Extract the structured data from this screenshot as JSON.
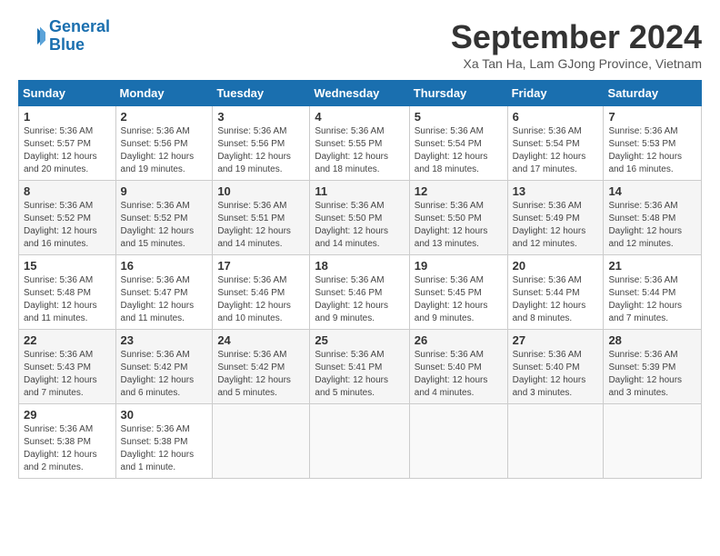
{
  "header": {
    "logo_line1": "General",
    "logo_line2": "Blue",
    "month": "September 2024",
    "location": "Xa Tan Ha, Lam GJong Province, Vietnam"
  },
  "weekdays": [
    "Sunday",
    "Monday",
    "Tuesday",
    "Wednesday",
    "Thursday",
    "Friday",
    "Saturday"
  ],
  "weeks": [
    [
      {
        "day": "1",
        "detail": "Sunrise: 5:36 AM\nSunset: 5:57 PM\nDaylight: 12 hours\nand 20 minutes."
      },
      {
        "day": "2",
        "detail": "Sunrise: 5:36 AM\nSunset: 5:56 PM\nDaylight: 12 hours\nand 19 minutes."
      },
      {
        "day": "3",
        "detail": "Sunrise: 5:36 AM\nSunset: 5:56 PM\nDaylight: 12 hours\nand 19 minutes."
      },
      {
        "day": "4",
        "detail": "Sunrise: 5:36 AM\nSunset: 5:55 PM\nDaylight: 12 hours\nand 18 minutes."
      },
      {
        "day": "5",
        "detail": "Sunrise: 5:36 AM\nSunset: 5:54 PM\nDaylight: 12 hours\nand 18 minutes."
      },
      {
        "day": "6",
        "detail": "Sunrise: 5:36 AM\nSunset: 5:54 PM\nDaylight: 12 hours\nand 17 minutes."
      },
      {
        "day": "7",
        "detail": "Sunrise: 5:36 AM\nSunset: 5:53 PM\nDaylight: 12 hours\nand 16 minutes."
      }
    ],
    [
      {
        "day": "8",
        "detail": "Sunrise: 5:36 AM\nSunset: 5:52 PM\nDaylight: 12 hours\nand 16 minutes."
      },
      {
        "day": "9",
        "detail": "Sunrise: 5:36 AM\nSunset: 5:52 PM\nDaylight: 12 hours\nand 15 minutes."
      },
      {
        "day": "10",
        "detail": "Sunrise: 5:36 AM\nSunset: 5:51 PM\nDaylight: 12 hours\nand 14 minutes."
      },
      {
        "day": "11",
        "detail": "Sunrise: 5:36 AM\nSunset: 5:50 PM\nDaylight: 12 hours\nand 14 minutes."
      },
      {
        "day": "12",
        "detail": "Sunrise: 5:36 AM\nSunset: 5:50 PM\nDaylight: 12 hours\nand 13 minutes."
      },
      {
        "day": "13",
        "detail": "Sunrise: 5:36 AM\nSunset: 5:49 PM\nDaylight: 12 hours\nand 12 minutes."
      },
      {
        "day": "14",
        "detail": "Sunrise: 5:36 AM\nSunset: 5:48 PM\nDaylight: 12 hours\nand 12 minutes."
      }
    ],
    [
      {
        "day": "15",
        "detail": "Sunrise: 5:36 AM\nSunset: 5:48 PM\nDaylight: 12 hours\nand 11 minutes."
      },
      {
        "day": "16",
        "detail": "Sunrise: 5:36 AM\nSunset: 5:47 PM\nDaylight: 12 hours\nand 11 minutes."
      },
      {
        "day": "17",
        "detail": "Sunrise: 5:36 AM\nSunset: 5:46 PM\nDaylight: 12 hours\nand 10 minutes."
      },
      {
        "day": "18",
        "detail": "Sunrise: 5:36 AM\nSunset: 5:46 PM\nDaylight: 12 hours\nand 9 minutes."
      },
      {
        "day": "19",
        "detail": "Sunrise: 5:36 AM\nSunset: 5:45 PM\nDaylight: 12 hours\nand 9 minutes."
      },
      {
        "day": "20",
        "detail": "Sunrise: 5:36 AM\nSunset: 5:44 PM\nDaylight: 12 hours\nand 8 minutes."
      },
      {
        "day": "21",
        "detail": "Sunrise: 5:36 AM\nSunset: 5:44 PM\nDaylight: 12 hours\nand 7 minutes."
      }
    ],
    [
      {
        "day": "22",
        "detail": "Sunrise: 5:36 AM\nSunset: 5:43 PM\nDaylight: 12 hours\nand 7 minutes."
      },
      {
        "day": "23",
        "detail": "Sunrise: 5:36 AM\nSunset: 5:42 PM\nDaylight: 12 hours\nand 6 minutes."
      },
      {
        "day": "24",
        "detail": "Sunrise: 5:36 AM\nSunset: 5:42 PM\nDaylight: 12 hours\nand 5 minutes."
      },
      {
        "day": "25",
        "detail": "Sunrise: 5:36 AM\nSunset: 5:41 PM\nDaylight: 12 hours\nand 5 minutes."
      },
      {
        "day": "26",
        "detail": "Sunrise: 5:36 AM\nSunset: 5:40 PM\nDaylight: 12 hours\nand 4 minutes."
      },
      {
        "day": "27",
        "detail": "Sunrise: 5:36 AM\nSunset: 5:40 PM\nDaylight: 12 hours\nand 3 minutes."
      },
      {
        "day": "28",
        "detail": "Sunrise: 5:36 AM\nSunset: 5:39 PM\nDaylight: 12 hours\nand 3 minutes."
      }
    ],
    [
      {
        "day": "29",
        "detail": "Sunrise: 5:36 AM\nSunset: 5:38 PM\nDaylight: 12 hours\nand 2 minutes."
      },
      {
        "day": "30",
        "detail": "Sunrise: 5:36 AM\nSunset: 5:38 PM\nDaylight: 12 hours\nand 1 minute."
      },
      null,
      null,
      null,
      null,
      null
    ]
  ]
}
